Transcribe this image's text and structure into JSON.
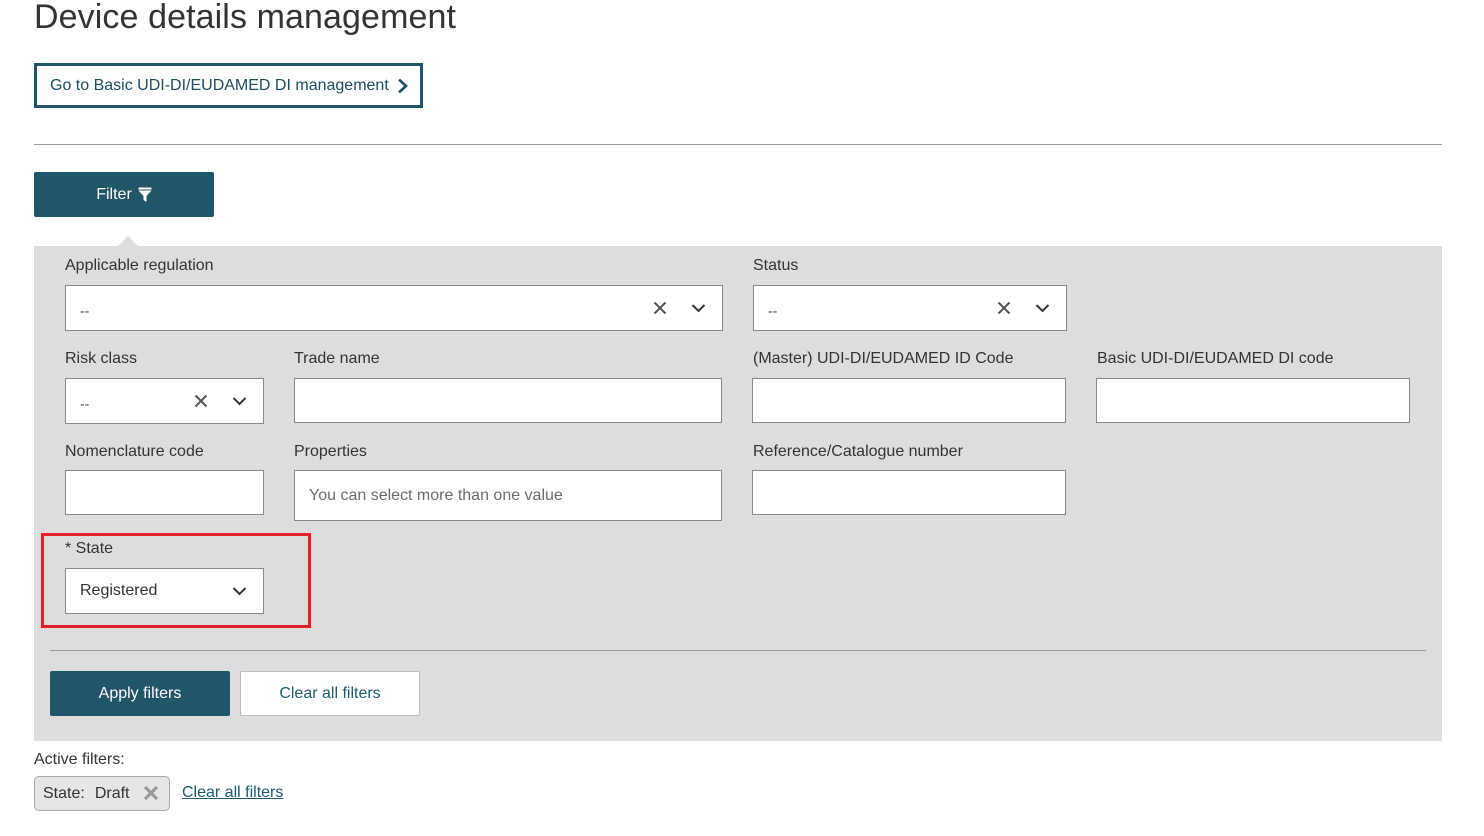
{
  "page_title": "Device details management",
  "goto_button": {
    "label": "Go to Basic UDI-DI/EUDAMED DI management",
    "icon": "chevron-right-icon"
  },
  "filter_button": {
    "label": "Filter",
    "icon": "funnel-icon"
  },
  "fields": {
    "applicable_regulation": {
      "label": "Applicable regulation",
      "value": "--"
    },
    "status": {
      "label": "Status",
      "value": "--"
    },
    "risk_class": {
      "label": "Risk class",
      "value": "--"
    },
    "trade_name": {
      "label": "Trade name",
      "value": ""
    },
    "master_udi": {
      "label": "(Master) UDI-DI/EUDAMED ID Code",
      "value": ""
    },
    "basic_udi": {
      "label": "Basic UDI-DI/EUDAMED DI code",
      "value": ""
    },
    "nomenclature_code": {
      "label": "Nomenclature code",
      "value": ""
    },
    "properties": {
      "label": "Properties",
      "placeholder": "You can select more than one value"
    },
    "reference_catalogue": {
      "label": "Reference/Catalogue number",
      "value": ""
    },
    "state": {
      "label": "* State",
      "value": "Registered"
    }
  },
  "actions": {
    "apply": "Apply filters",
    "clear": "Clear all filters"
  },
  "active_filters": {
    "label": "Active filters:",
    "chips": [
      {
        "key": "State:",
        "value": "Draft"
      }
    ],
    "clear_link": "Clear all filters"
  },
  "colors": {
    "primary": "#215569",
    "panel_bg": "#dddddd",
    "highlight": "#e0232b",
    "link": "#1c5a74"
  }
}
